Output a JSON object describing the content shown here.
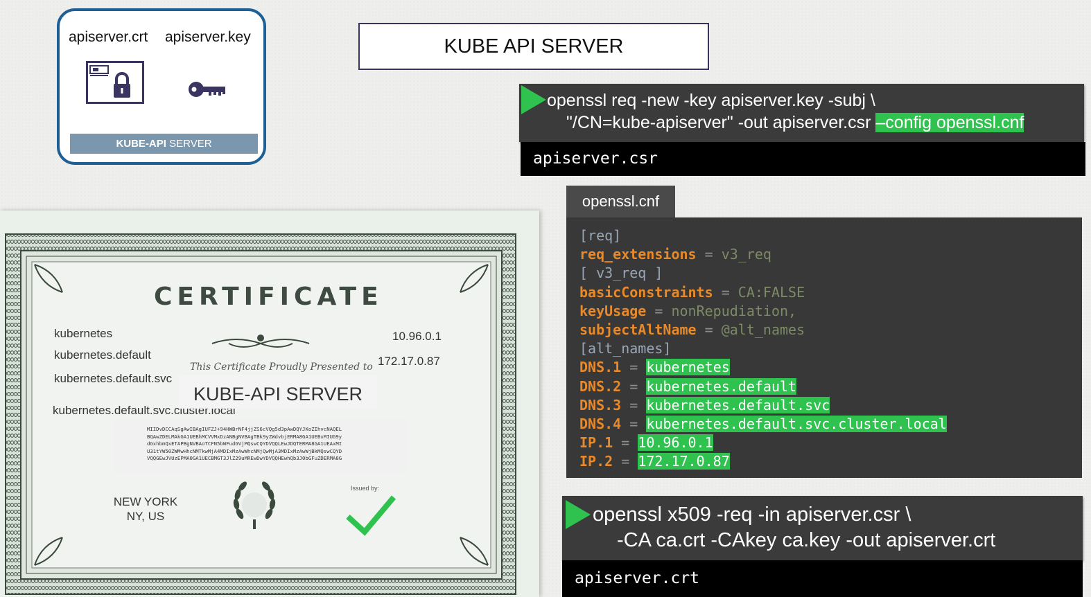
{
  "keys_card": {
    "cert_file": "apiserver.crt",
    "key_file": "apiserver.key",
    "band_label_bold": "KUBE-API",
    "band_label_rest": " SERVER",
    "icons": [
      "certificate-lock-icon",
      "key-icon"
    ]
  },
  "title": "KUBE API SERVER",
  "req_command": {
    "line1": "openssl req -new -key apiserver.key -subj \\",
    "line2_prefix": "\"/CN=kube-apiserver\" -out apiserver.csr ",
    "line2_highlight": "–config openssl.cnf",
    "output": "apiserver.csr"
  },
  "openssl_cnf": {
    "tab_label": "openssl.cnf",
    "lines": {
      "l1": "[req]",
      "l2_key": "req_extensions",
      "l2_val": "v3_req",
      "l3": "[ v3_req ]",
      "l4_key": "basicConstraints",
      "l4_val": "CA:FALSE",
      "l5_key": "keyUsage",
      "l5_val": "nonRepudiation,",
      "l6_key": "subjectAltName",
      "l6_val": "@alt_names",
      "l7": "[alt_names]",
      "l8_key": "DNS.1",
      "l8_val": "kubernetes",
      "l9_key": "DNS.2",
      "l9_val": "kubernetes.default",
      "l10_key": "DNS.3",
      "l10_val": "kubernetes.default.svc",
      "l11_key": "DNS.4",
      "l11_val": "kubernetes.default.svc.cluster.local",
      "l12_key": "IP.1",
      "l12_val": "10.96.0.1",
      "l13_key": "IP.2",
      "l13_val": "172.17.0.87"
    },
    "equals": "="
  },
  "x509_command": {
    "line1": "openssl x509 -req -in apiserver.csr \\",
    "line2": "-CA ca.crt -CAkey ca.key -out apiserver.crt",
    "output": "apiserver.crt"
  },
  "certificate": {
    "heading": "CERTIFICATE",
    "names": {
      "n1": "kubernetes",
      "n2": "kubernetes.default",
      "n3": "kubernetes.default.svc",
      "n4": "kubernetes.default.svc.cluster.local",
      "ip1": "10.96.0.1",
      "ip2": "172.17.0.87"
    },
    "presented_to": "This Certificate Proudly Presented to",
    "recipient": "KUBE-API SERVER",
    "encoded": "MIIDvDCCAqSgAwIBAgIUFZJ+94HWBrNF4jjZS6cVQg5d3pAwDQYJKoZIhvcNAQEL\nBQAwZDELMAkGA1UEBhMCVVMxDzANBgNVBAgTBk9yZWdvbjERMA8GA1UEBxMIUG9y\ndGxhbmQxETAPBgNVBAoTCFN5bWFudGVjMQswCQYDVQQLEwJDQTERMA8GA1UEAxMI\nU31tYW50ZWMwHhcNMTkwMjA4MDIxMzAwWhcNMjQwMjA3MDIxMzAwWjBkMQswCQYD\nVQQGEwJVUzEPMA0GA1UECBMGT3JlZ29uMREwDwYDVQQHEwhQb3J0bGFuZDERMA8G",
    "location_line1": "NEW YORK",
    "location_line2": "NY, US",
    "issued_by": "Issued by:"
  },
  "colors": {
    "accent_green": "#2fc24f",
    "card_border": "#1f5f94",
    "config_key": "#e8892a",
    "panel_dark": "#3b3b3b"
  }
}
